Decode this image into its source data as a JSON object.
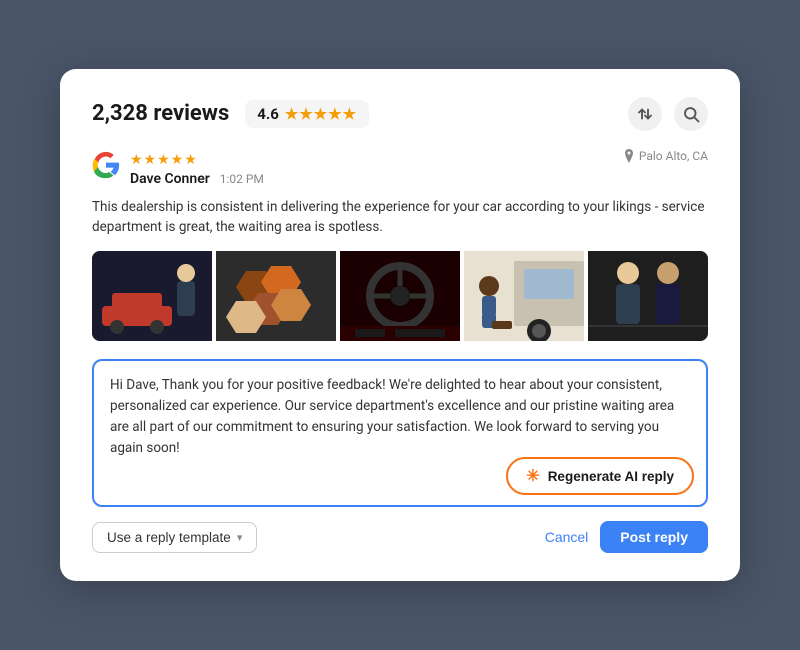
{
  "header": {
    "review_count": "2,328 reviews",
    "rating": "4.6",
    "stars": "★★★★★",
    "sort_icon": "↕",
    "search_icon": "🔍"
  },
  "reviewer": {
    "name": "Dave Conner",
    "time": "1:02 PM",
    "stars": "★★★★★",
    "location": "Palo Alto, CA"
  },
  "review": {
    "text": "This dealership is consistent in delivering the experience for your car according to your likings -  service department is great, the waiting area is spotless."
  },
  "reply": {
    "text": "Hi Dave, Thank you for your positive feedback! We're delighted to hear about your consistent, personalized car experience. Our service department's excellence and our pristine waiting area are all part of our commitment to ensuring your satisfaction. We look forward to serving you again soon!",
    "regenerate_label": "Regenerate AI reply"
  },
  "actions": {
    "template_label": "Use a reply template",
    "cancel_label": "Cancel",
    "post_label": "Post reply"
  }
}
